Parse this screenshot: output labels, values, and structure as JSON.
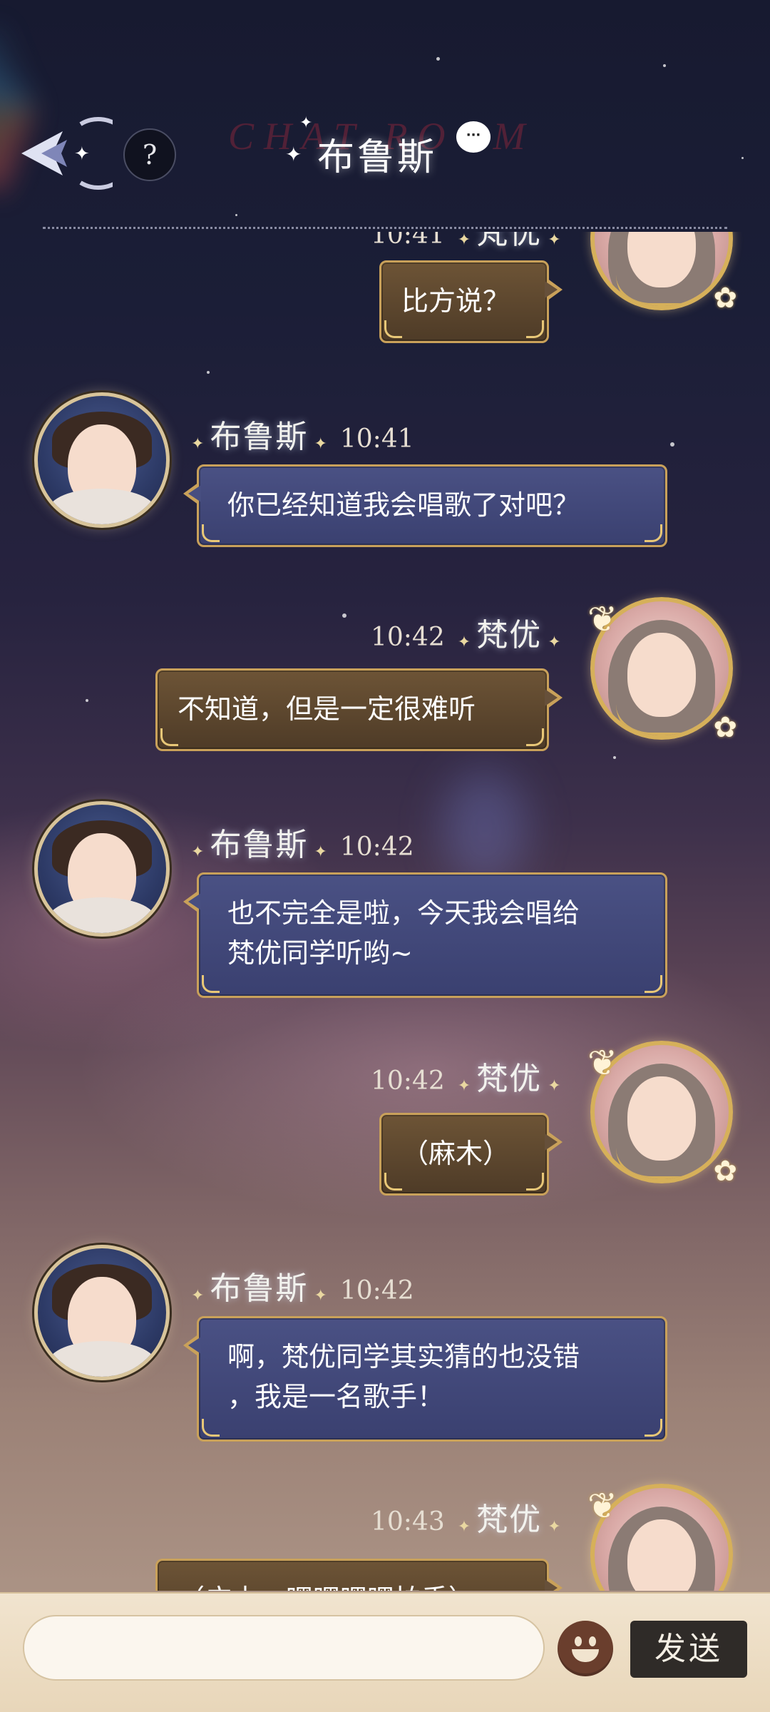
{
  "header": {
    "title": "布鲁斯",
    "watermark": "CHAT ROOM",
    "help_label": "?"
  },
  "participants": {
    "bruce": "布鲁斯",
    "fanyou": "梵优"
  },
  "messages": [
    {
      "sender": "梵优",
      "side": "right",
      "time": "10:41",
      "text": "比方说？"
    },
    {
      "sender": "布鲁斯",
      "side": "left",
      "time": "10:41",
      "text": "你已经知道我会唱歌了对吧？"
    },
    {
      "sender": "梵优",
      "side": "right",
      "time": "10:42",
      "text": "不知道，但是一定很难听"
    },
    {
      "sender": "布鲁斯",
      "side": "left",
      "time": "10:42",
      "lines": [
        "也不完全是啦，今天我会唱给",
        "梵优同学听哟~"
      ]
    },
    {
      "sender": "梵优",
      "side": "right",
      "time": "10:42",
      "text": "（麻木）"
    },
    {
      "sender": "布鲁斯",
      "side": "left",
      "time": "10:42",
      "lines": [
        "啊，梵优同学其实猜的也没错",
        "，我是一名歌手！"
      ]
    },
    {
      "sender": "梵优",
      "side": "right",
      "time": "10:43",
      "text": "（广木，嘿嘿嘿嘿拍手）"
    }
  ],
  "input": {
    "placeholder": "",
    "send_label": "发送"
  },
  "colors": {
    "bubble_self": "#5e4830",
    "bubble_other": "#434a7c",
    "bubble_border": "#c9a15a"
  }
}
